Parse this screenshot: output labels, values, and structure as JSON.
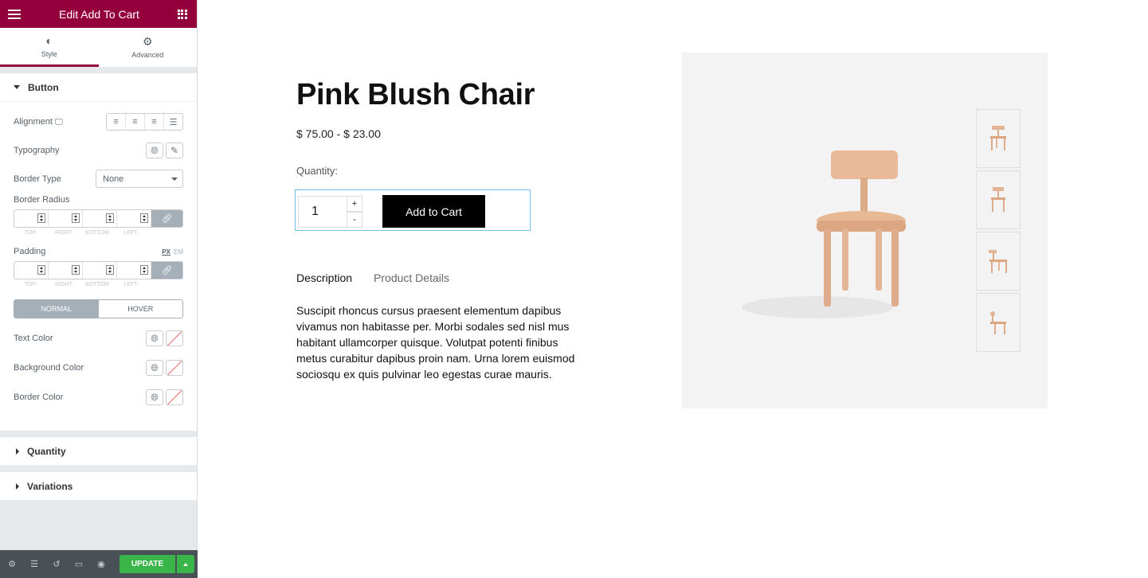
{
  "sidebar": {
    "title": "Edit Add To Cart",
    "tabs": [
      {
        "label": "Style",
        "icon": "contrast-icon"
      },
      {
        "label": "Advanced",
        "icon": "gear-icon"
      }
    ],
    "button_section": {
      "title": "Button",
      "alignment_label": "Alignment",
      "typography_label": "Typography",
      "border_type_label": "Border Type",
      "border_type_value": "None",
      "border_radius_label": "Border Radius",
      "padding_label": "Padding",
      "units": [
        "PX",
        "EM"
      ],
      "dimension_labels": [
        "TOP",
        "RIGHT",
        "BOTTOM",
        "LEFT"
      ],
      "state_tabs": [
        "NORMAL",
        "HOVER"
      ],
      "text_color_label": "Text Color",
      "bg_color_label": "Background Color",
      "border_color_label": "Border Color"
    },
    "quantity_section": "Quantity",
    "variations_section": "Variations",
    "update_label": "UPDATE"
  },
  "product": {
    "title": "Pink Blush Chair",
    "price": "$ 75.00 - $ 23.00",
    "quantity_label": "Quantity:",
    "quantity_value": "1",
    "plus": "+",
    "minus": "-",
    "add_to_cart": "Add to Cart",
    "tabs": [
      "Description",
      "Product Details"
    ],
    "description": "Suscipit rhoncus cursus praesent elementum dapibus vivamus non habitasse per. Morbi sodales sed nisl mus habitant ullamcorper quisque. Volutpat potenti finibus metus curabitur dapibus proin nam. Urna lorem euismod sociosqu ex quis pulvinar leo egestas curae mauris."
  },
  "colors": {
    "brand": "#93003c",
    "update_green": "#39b54a",
    "footer": "#495157"
  }
}
